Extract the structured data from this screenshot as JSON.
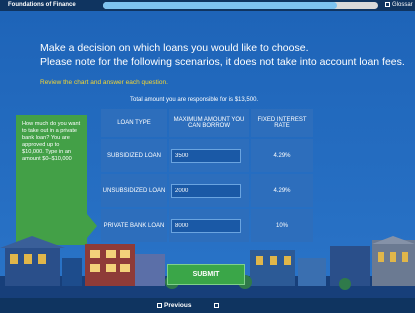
{
  "topbar": {
    "app_title": "Foundations of Finance",
    "progress": 0.85,
    "glossary_label": "Glossar"
  },
  "content": {
    "heading_line1": "Make a decision on which loans you would like to choose.",
    "heading_line2": "Please note for the following scenarios, it does not take into account loan fees.",
    "instruction": "Review the chart and answer each question.",
    "total": "Total amount you are responsible for is $13,500.",
    "prompt": "How much do you want to take out in a private bank loan? You are approved up to $10,000. Type in an amount $0–$10,000"
  },
  "table": {
    "headers": [
      "LOAN TYPE",
      "MAXIMUM AMOUNT YOU CAN BORROW",
      "FIXED INTEREST RATE"
    ],
    "rows": [
      {
        "type": "SUBSIDIZED LOAN",
        "amount": "3500",
        "rate": "4.29%"
      },
      {
        "type": "UNSUBSIDIZED LOAN",
        "amount": "2000",
        "rate": "4.29%"
      },
      {
        "type": "PRIVATE BANK LOAN",
        "amount": "8000",
        "rate": "10%"
      }
    ]
  },
  "submit_label": "SUBMIT",
  "nav": {
    "previous_label": "Previous"
  },
  "colors": {
    "background": "#1f5fb0",
    "bar": "#0f3460",
    "accent_green": "#43a047",
    "instruction_yellow": "#f2d533"
  }
}
